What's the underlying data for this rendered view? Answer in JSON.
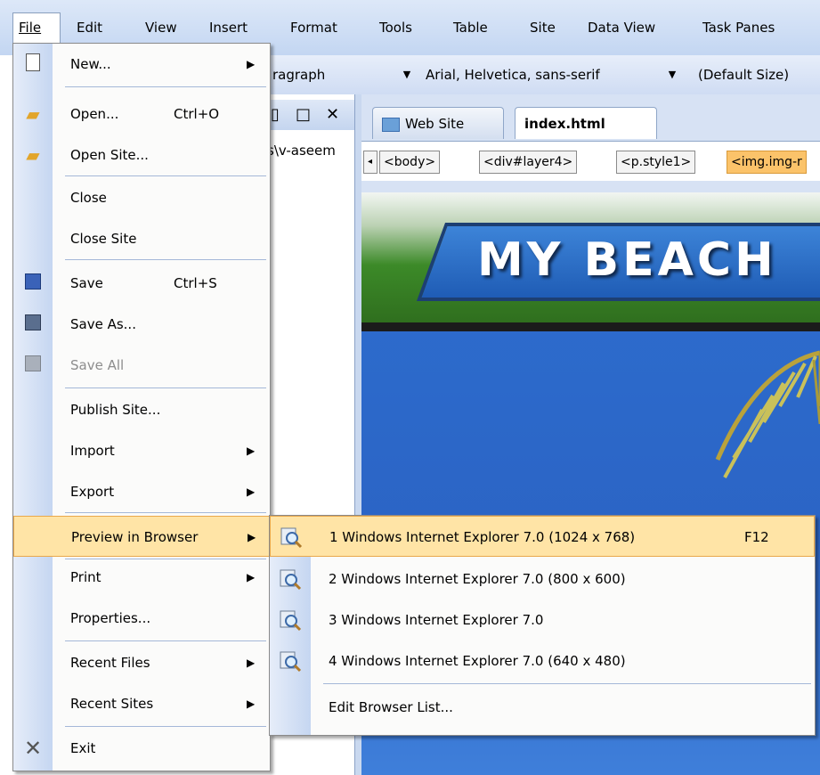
{
  "menubar": {
    "items": [
      {
        "label": "File",
        "mnemonic": "F"
      },
      {
        "label": "Edit",
        "mnemonic": "E"
      },
      {
        "label": "View",
        "mnemonic": "V"
      },
      {
        "label": "Insert",
        "mnemonic": "I"
      },
      {
        "label": "Format",
        "mnemonic": "o"
      },
      {
        "label": "Tools",
        "mnemonic": "T"
      },
      {
        "label": "Table",
        "mnemonic": "a"
      },
      {
        "label": "Site",
        "mnemonic": "S"
      },
      {
        "label": "Data View",
        "mnemonic": "D"
      },
      {
        "label": "Task Panes",
        "mnemonic": "k"
      }
    ]
  },
  "format_toolbar": {
    "style_value": "ragraph",
    "font_value": "Arial, Helvetica, sans-serif",
    "size_value": "(Default Size)"
  },
  "folder_pane": {
    "path_text": "s\\v-aseem",
    "pin_icon": "pin-icon",
    "close_glyph": "✕"
  },
  "editor": {
    "tabs": [
      {
        "label": "Web Site"
      },
      {
        "label": "index.html"
      }
    ],
    "breadcrumbs": [
      "<body>",
      "<div#layer4>",
      "<p.style1>",
      "<img.img-r"
    ],
    "banner_text": "MY BEACH"
  },
  "file_menu": {
    "items": [
      {
        "label": "New...",
        "shortcut": "",
        "has_submenu": true,
        "icon": "new-page-icon"
      },
      {
        "label": "Open...",
        "shortcut": "Ctrl+O",
        "has_submenu": false,
        "icon": "open-folder-icon"
      },
      {
        "label": "Open Site...",
        "shortcut": "",
        "has_submenu": false,
        "icon": "open-site-icon"
      },
      {
        "label": "Close",
        "shortcut": "",
        "has_submenu": false,
        "icon": ""
      },
      {
        "label": "Close Site",
        "shortcut": "",
        "has_submenu": false,
        "icon": ""
      },
      {
        "label": "Save",
        "shortcut": "Ctrl+S",
        "has_submenu": false,
        "icon": "save-icon"
      },
      {
        "label": "Save As...",
        "shortcut": "",
        "has_submenu": false,
        "icon": "save-as-icon"
      },
      {
        "label": "Save All",
        "shortcut": "",
        "has_submenu": false,
        "icon": "save-all-icon",
        "disabled": true
      },
      {
        "label": "Publish Site...",
        "shortcut": "",
        "has_submenu": false,
        "icon": ""
      },
      {
        "label": "Import",
        "shortcut": "",
        "has_submenu": true,
        "icon": ""
      },
      {
        "label": "Export",
        "shortcut": "",
        "has_submenu": true,
        "icon": ""
      },
      {
        "label": "Preview in Browser",
        "shortcut": "",
        "has_submenu": true,
        "icon": "",
        "highlighted": true
      },
      {
        "label": "Print",
        "shortcut": "",
        "has_submenu": true,
        "icon": ""
      },
      {
        "label": "Properties...",
        "shortcut": "",
        "has_submenu": false,
        "icon": ""
      },
      {
        "label": "Recent Files",
        "shortcut": "",
        "has_submenu": true,
        "icon": ""
      },
      {
        "label": "Recent Sites",
        "shortcut": "",
        "has_submenu": true,
        "icon": ""
      },
      {
        "label": "Exit",
        "shortcut": "",
        "has_submenu": false,
        "icon": "exit-x-icon"
      }
    ]
  },
  "preview_submenu": {
    "items": [
      {
        "label": "1 Windows Internet Explorer 7.0 (1024 x 768)",
        "shortcut": "F12",
        "icon": "browser-preview-icon",
        "highlighted": true
      },
      {
        "label": "2 Windows Internet Explorer 7.0 (800 x 600)",
        "shortcut": "",
        "icon": "browser-preview-icon"
      },
      {
        "label": "3 Windows Internet Explorer 7.0",
        "shortcut": "",
        "icon": "browser-preview-icon"
      },
      {
        "label": "4 Windows Internet Explorer 7.0 (640 x 480)",
        "shortcut": "",
        "icon": "browser-preview-icon"
      },
      {
        "label": "Edit Browser List...",
        "shortcut": "",
        "icon": ""
      }
    ]
  },
  "colors": {
    "menu_highlight": "#ffe4a6",
    "menu_highlight_border": "#e9a84b",
    "breadcrumb_selected": "#fbc36a",
    "toolbar_blue": "#c3d6f2"
  }
}
